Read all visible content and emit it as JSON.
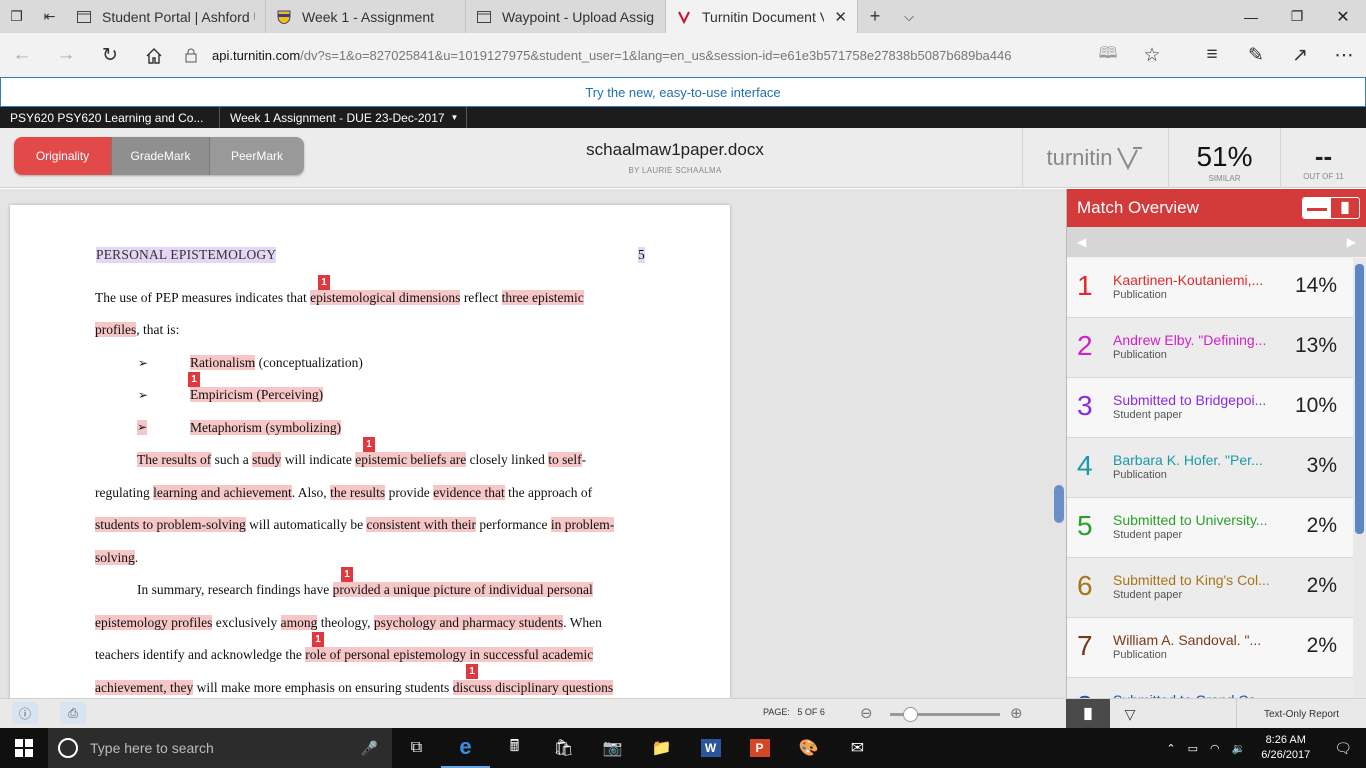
{
  "browser": {
    "tabs": [
      {
        "title": "Student Portal | Ashford Uni"
      },
      {
        "title": "Week 1 - Assignment"
      },
      {
        "title": "Waypoint - Upload Assignm"
      },
      {
        "title": "Turnitin Document Viev",
        "active": true
      }
    ],
    "url_host": "api.turnitin.com",
    "url_path": "/dv?s=1&o=827025841&u=1019127975&student_user=1&lang=en_us&session-id=e61e3b571758e27838b5087b689ba446"
  },
  "banner": {
    "try_new": "Try the new, easy-to-use interface"
  },
  "course_bar": {
    "course": "PSY620 PSY620 Learning and Co...",
    "assignment": "Week 1 Assignment - DUE 23-Dec-2017"
  },
  "header": {
    "modes": [
      "Originality",
      "GradeMark",
      "PeerMark"
    ],
    "file_name": "schaalmaw1paper.docx",
    "author": "BY LAURIE SCHAALMA",
    "logo": "turnitin",
    "similarity": "51%",
    "similarity_label": "SIMILAR",
    "out_of_value": "--",
    "out_of_label": "OUT OF 11"
  },
  "document": {
    "heading": "PERSONAL EPISTEMOLOGY",
    "page_number": "5",
    "markers": [
      "1",
      "1",
      "1",
      "1",
      "1",
      "1"
    ],
    "line1": {
      "a": "The use of PEP measures indicates that ",
      "b": "epistemological dimensions",
      "c": " reflect ",
      "d": "three epistemic"
    },
    "line2": {
      "a": "profiles",
      "b": ", that is:"
    },
    "bullet1": {
      "a": "Rationalism",
      "b": " (conceptualization)"
    },
    "bullet2": {
      "a": "Empiricism (Perceiving)"
    },
    "bullet3": {
      "a": "Metaphorism (symbolizing)"
    },
    "line3": {
      "a": "The results of",
      "b": " such a ",
      "c": "study",
      "d": " will indicate ",
      "e": "epistemic beliefs are",
      "f": " closely linked ",
      "g": "to self",
      "h": "-"
    },
    "line4": {
      "a": "regulating ",
      "b": "learning and achievement",
      "c": ". Also, ",
      "d": "the results",
      "e": " provide ",
      "f": "evidence that",
      "g": " the approach of"
    },
    "line5": {
      "a": "students to problem-solving",
      "b": " will automatically be ",
      "c": "consistent with their",
      "d": " performance ",
      "e": "in problem-"
    },
    "line6": {
      "a": "solving",
      "b": "."
    },
    "line7": {
      "a": "In summary, research findings have ",
      "b": "provided a unique picture of individual personal"
    },
    "line8": {
      "a": "epistemology profiles",
      "b": " exclusively ",
      "c": "among",
      "d": " theology, ",
      "e": "psychology and pharmacy students",
      "f": ". When"
    },
    "line9": {
      "a": "teachers identify and acknowledge the ",
      "b": "role of personal epistemology in successful academic"
    },
    "line10": {
      "a": "achievement, they",
      "b": " will make more emphasis on ensuring students ",
      "c": "discuss disciplinary questions"
    }
  },
  "match_overview": {
    "title": "Match Overview",
    "matches": [
      {
        "num": "1",
        "source": "Kaartinen-Koutaniemi,...",
        "type": "Publication",
        "pct": "14%",
        "color": "#e0282e"
      },
      {
        "num": "2",
        "source": "Andrew Elby. \"Defining...",
        "type": "Publication",
        "pct": "13%",
        "color": "#d21fc8"
      },
      {
        "num": "3",
        "source": "Submitted to Bridgepoi...",
        "type": "Student paper",
        "pct": "10%",
        "color": "#8a2be2"
      },
      {
        "num": "4",
        "source": "Barbara K. Hofer. \"Per...",
        "type": "Publication",
        "pct": "3%",
        "color": "#1a9aa8"
      },
      {
        "num": "5",
        "source": "Submitted to University...",
        "type": "Student paper",
        "pct": "2%",
        "color": "#2aa02a"
      },
      {
        "num": "6",
        "source": "Submitted to King's Col...",
        "type": "Student paper",
        "pct": "2%",
        "color": "#a8741a"
      },
      {
        "num": "7",
        "source": "William A. Sandoval. \"...",
        "type": "Publication",
        "pct": "2%",
        "color": "#7a3a14"
      },
      {
        "num": "8",
        "source": "Submitted to Grand Ca...",
        "type": "",
        "pct": "",
        "color": "#1f4fa0"
      }
    ]
  },
  "status_bar": {
    "page_label": "PAGE:",
    "page_value": "5 OF 6",
    "text_only": "Text-Only Report",
    "zoom_fraction": 0.18
  },
  "taskbar": {
    "search_placeholder": "Type here to search",
    "time": "8:26 AM",
    "date": "6/26/2017"
  }
}
